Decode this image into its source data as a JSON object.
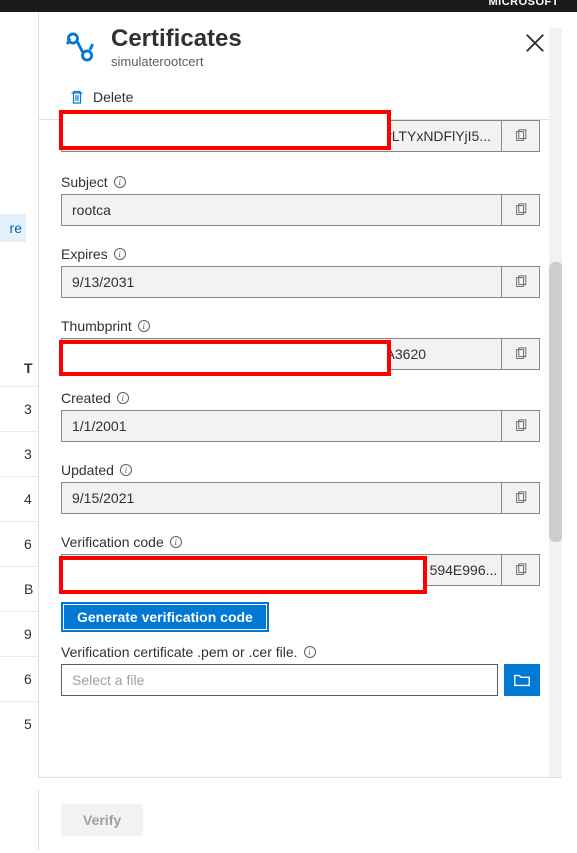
{
  "topbar": {
    "org": "MICROSOFT"
  },
  "leftStub": {
    "link": "re",
    "header": "T",
    "rows": [
      "3",
      "3",
      "4",
      "6",
      "B",
      "9",
      "6",
      "5"
    ]
  },
  "blade": {
    "title": "Certificates",
    "subtitle": "simulaterootcert",
    "toolbar": {
      "delete": "Delete"
    },
    "fields": {
      "first": {
        "visible_suffix": "vLTYxNDFlYjI5..."
      },
      "subject": {
        "label": "Subject",
        "value": "rootca"
      },
      "expires": {
        "label": "Expires",
        "value": "9/13/2031"
      },
      "thumbprint": {
        "label": "Thumbprint",
        "visible_suffix": "A3620"
      },
      "created": {
        "label": "Created",
        "value": "1/1/2001"
      },
      "updated": {
        "label": "Updated",
        "value": "9/15/2021"
      },
      "verification": {
        "label": "Verification code",
        "visible_suffix": "594E996..."
      }
    },
    "actions": {
      "generate": "Generate verification code",
      "upload_label": "Verification certificate .pem or .cer file.",
      "file_placeholder": "Select a file",
      "verify": "Verify"
    }
  }
}
